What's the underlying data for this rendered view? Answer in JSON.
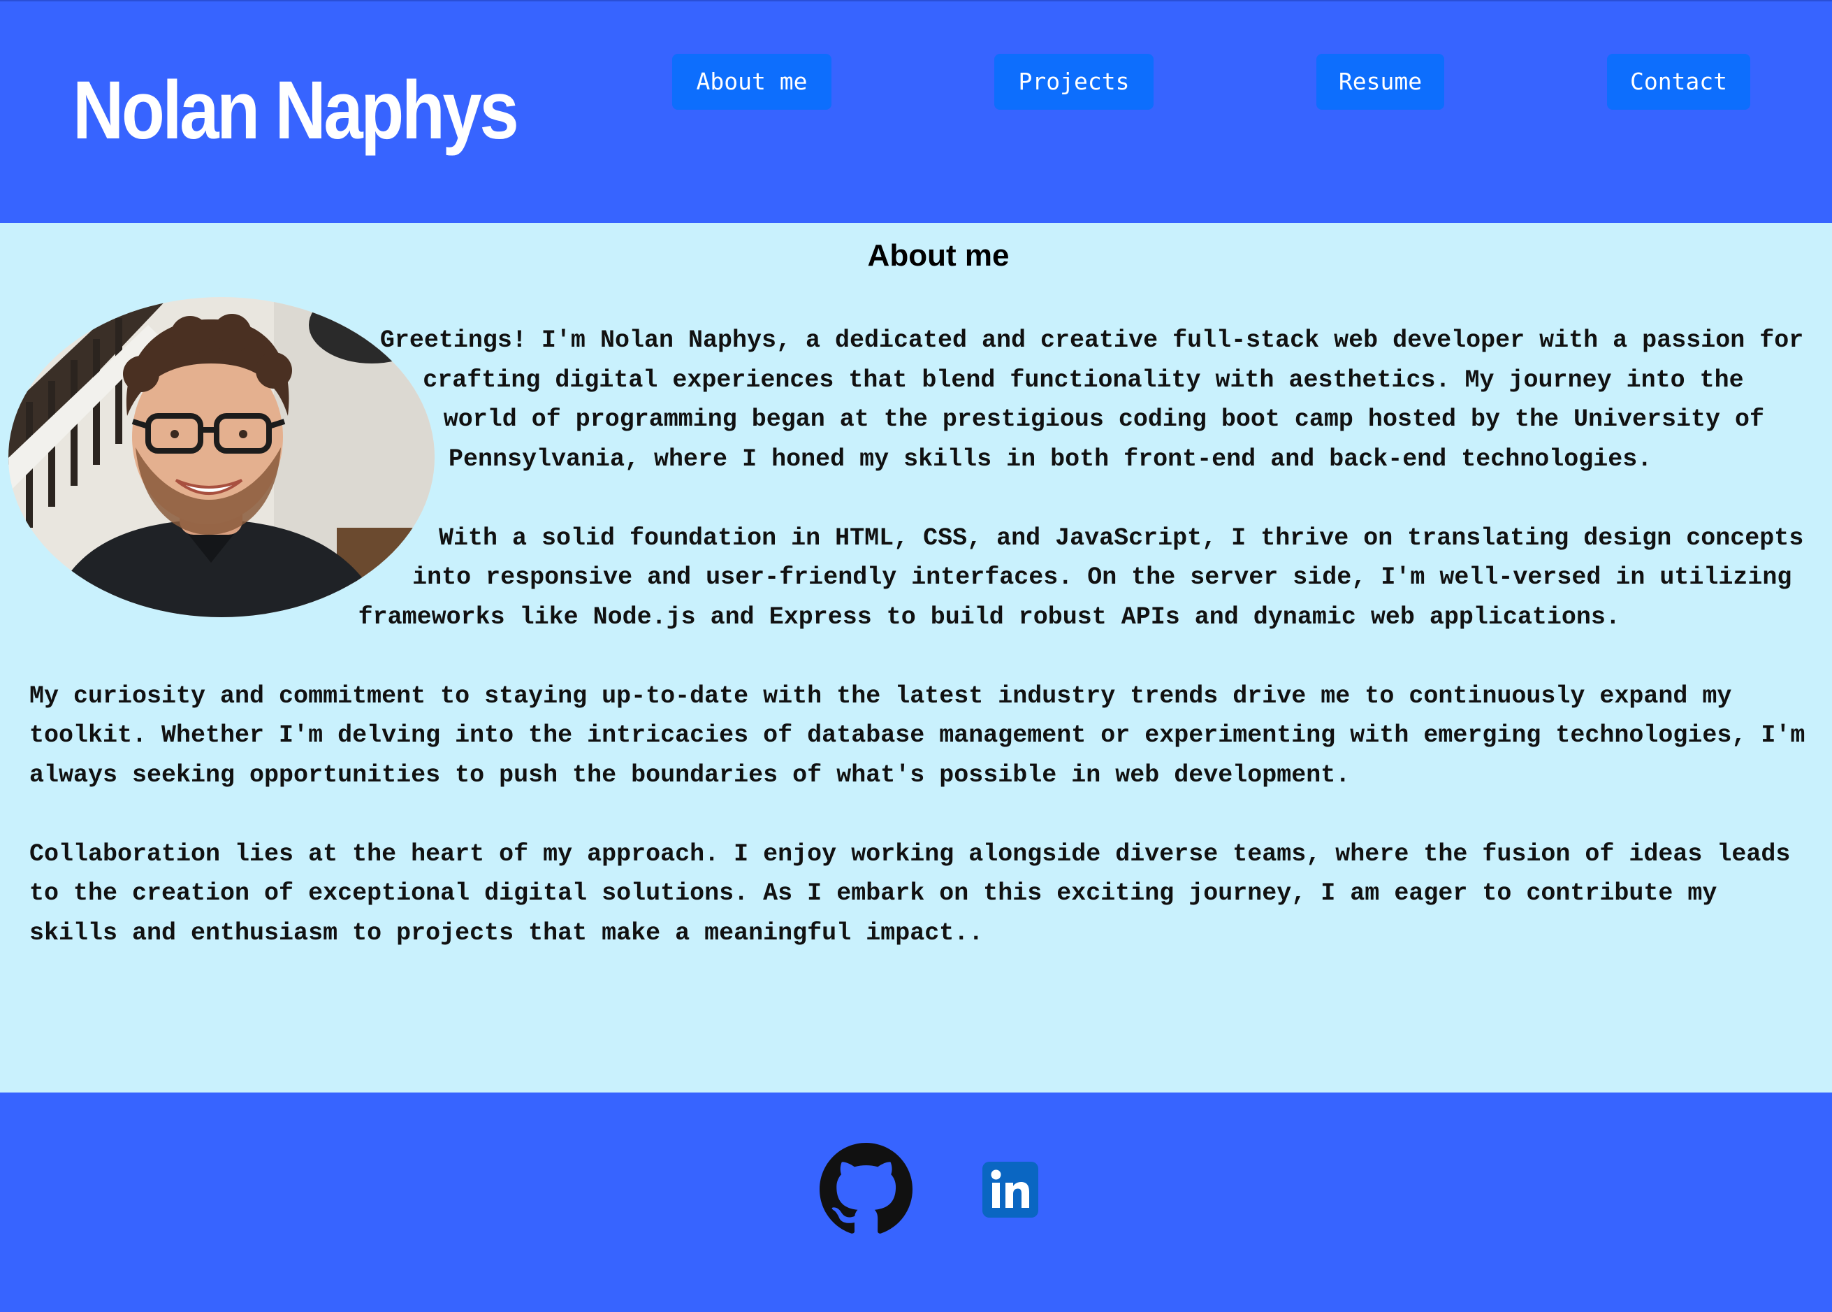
{
  "header": {
    "brand": "Nolan Naphys",
    "nav": [
      {
        "label": "About me"
      },
      {
        "label": "Projects"
      },
      {
        "label": "Resume"
      },
      {
        "label": "Contact"
      }
    ]
  },
  "about": {
    "title": "About me",
    "portrait_icon": "portrait-photo",
    "paragraphs": [
      "Greetings! I'm Nolan Naphys, a dedicated and creative full-stack web developer with a passion for crafting digital experiences that blend functionality with aesthetics. My journey into the world of programming began at the prestigious coding boot camp hosted by the University of Pennsylvania, where I honed my skills in both front-end and back-end technologies.",
      "With a solid foundation in HTML, CSS, and JavaScript, I thrive on translating design concepts into responsive and user-friendly interfaces. On the server side, I'm well-versed in utilizing frameworks like Node.js and Express to build robust APIs and dynamic web applications.",
      "My curiosity and commitment to staying up-to-date with the latest industry trends drive me to continuously expand my toolkit. Whether I'm delving into the intricacies of database management or experimenting with emerging technologies, I'm always seeking opportunities to push the boundaries of what's possible in web development.",
      "Collaboration lies at the heart of my approach. I enjoy working alongside diverse teams, where the fusion of ideas leads to the creation of exceptional digital solutions. As I embark on this exciting journey, I am eager to contribute my skills and enthusiasm to projects that make a meaningful impact.."
    ]
  },
  "footer": {
    "links": [
      {
        "icon": "github-icon"
      },
      {
        "icon": "linkedin-icon"
      }
    ]
  },
  "colors": {
    "header_bg": "#3764ff",
    "nav_button_bg": "#0d6efd",
    "about_bg": "#c9f1fd",
    "footer_bg": "#3764ff",
    "linkedin_blue": "#0a66c2"
  }
}
